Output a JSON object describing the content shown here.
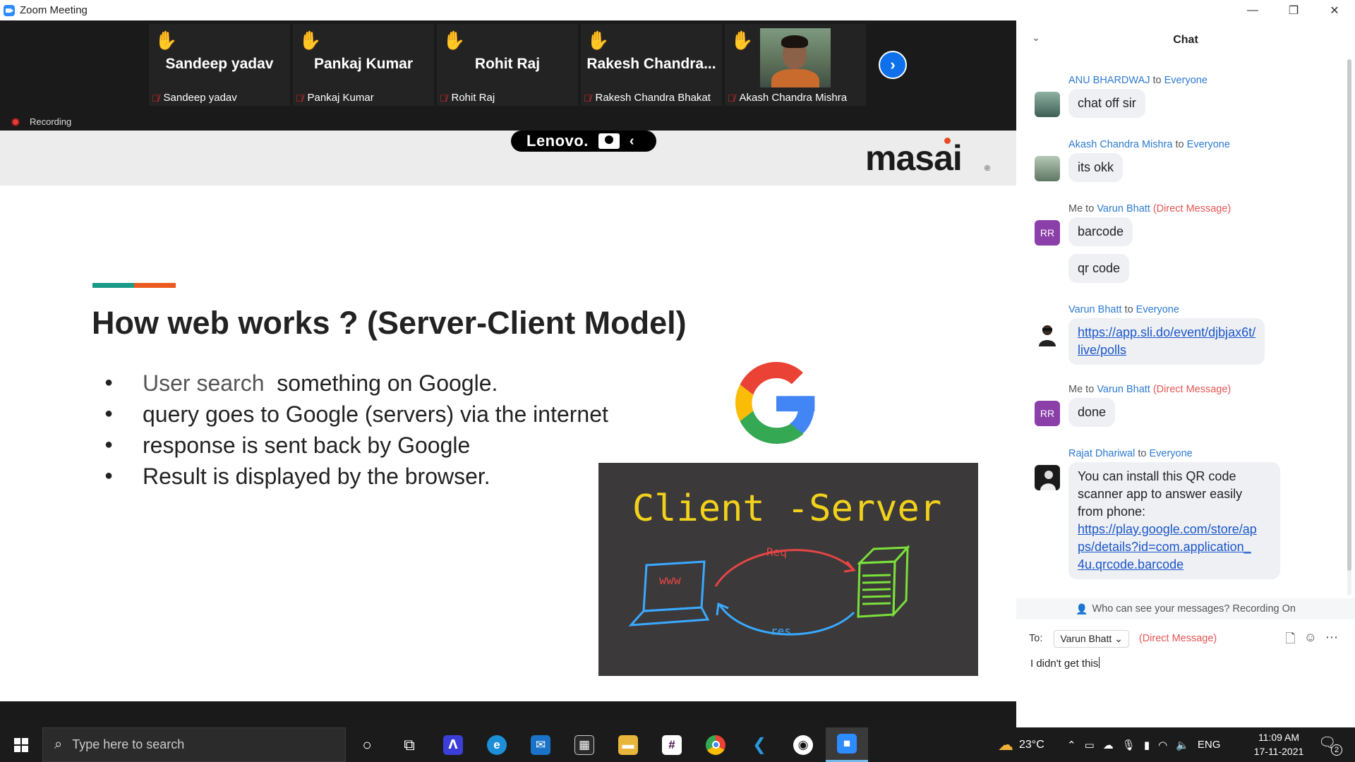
{
  "window": {
    "title": "Zoom Meeting",
    "controls": [
      "—",
      "❐",
      "✕"
    ]
  },
  "participants": [
    {
      "display_name": "Sandeep yadav",
      "caption": "Sandeep yadav",
      "hand_raised": true,
      "video": false
    },
    {
      "display_name": "Pankaj Kumar",
      "caption": "Pankaj Kumar",
      "hand_raised": true,
      "video": false
    },
    {
      "display_name": "Rohit Raj",
      "caption": "Rohit Raj",
      "hand_raised": true,
      "video": false
    },
    {
      "display_name": "Rakesh  Chandra...",
      "caption": "Rakesh Chandra Bhakat",
      "hand_raised": true,
      "video": false
    },
    {
      "display_name": "",
      "caption": "Akash Chandra Mishra",
      "hand_raised": true,
      "video": true
    }
  ],
  "recording_label": "Recording",
  "slide": {
    "toolbar_brand": "Lenovo.",
    "logo": "masai",
    "logo_reg": "®",
    "title": "How web works ? (Server-Client Model)",
    "bullets": [
      {
        "prefix": "User search",
        "text": "  something on Google."
      },
      {
        "prefix": "",
        "text": "query goes to Google (servers) via the internet"
      },
      {
        "prefix": "",
        "text": "response is sent back by Google"
      },
      {
        "prefix": "",
        "text": "Result is displayed by the browser."
      }
    ],
    "image_text": {
      "title": "Client -Server",
      "req": "Req",
      "res": "res",
      "www": "www"
    },
    "colors": {
      "teal": "#1b9a8a",
      "orange": "#ea5a1f"
    }
  },
  "chat": {
    "title": "Chat",
    "messages": [
      {
        "sender": "ANU BHARDWAJ",
        "to_word": " to ",
        "recipient": "Everyone",
        "dm": "",
        "avatar": "photo",
        "texts": [
          "chat off sir"
        ]
      },
      {
        "sender": "Akash Chandra Mishra",
        "to_word": " to ",
        "recipient": "Everyone",
        "dm": "",
        "avatar": "photo",
        "texts": [
          "its okk"
        ]
      },
      {
        "sender": "Me",
        "to_word": " to ",
        "recipient": "Varun Bhatt",
        "dm": " (Direct Message)",
        "avatar": "RR",
        "texts": [
          "barcode",
          "qr code"
        ]
      },
      {
        "sender": "Varun Bhatt",
        "to_word": " to ",
        "recipient": "Everyone",
        "dm": "",
        "avatar": "photo",
        "link_lines": [
          "https://app.sli.do/event/djbjax6t/",
          "live/polls"
        ]
      },
      {
        "sender": "Me",
        "to_word": " to ",
        "recipient": "Varun Bhatt",
        "dm": " (Direct Message)",
        "avatar": "RR",
        "texts": [
          "done"
        ]
      },
      {
        "sender": "Rajat Dhariwal",
        "to_word": " to ",
        "recipient": "Everyone",
        "dm": "",
        "avatar": "photo",
        "text_lines": [
          "You can install this QR code",
          "scanner app to answer easily",
          "from phone:"
        ],
        "link_lines": [
          "https://play.google.com/store/ap",
          "ps/details?id=com.application_",
          "4u.qrcode.barcode"
        ]
      }
    ],
    "notice": "Who can see your messages? Recording On",
    "to_label": "To:",
    "to_recipient": "Varun Bhatt",
    "to_dm": "(Direct Message)",
    "input_value": "I didn't get this"
  },
  "taskbar": {
    "search_placeholder": "Type here to search",
    "apps": [
      "cortana",
      "task-view",
      "azure",
      "edge",
      "mail",
      "store",
      "explorer",
      "slack",
      "chrome",
      "vscode",
      "obs",
      "zoom"
    ],
    "weather": "23°C",
    "language": "ENG",
    "time": "11:09 AM",
    "date": "17-11-2021",
    "notifications": "2"
  }
}
